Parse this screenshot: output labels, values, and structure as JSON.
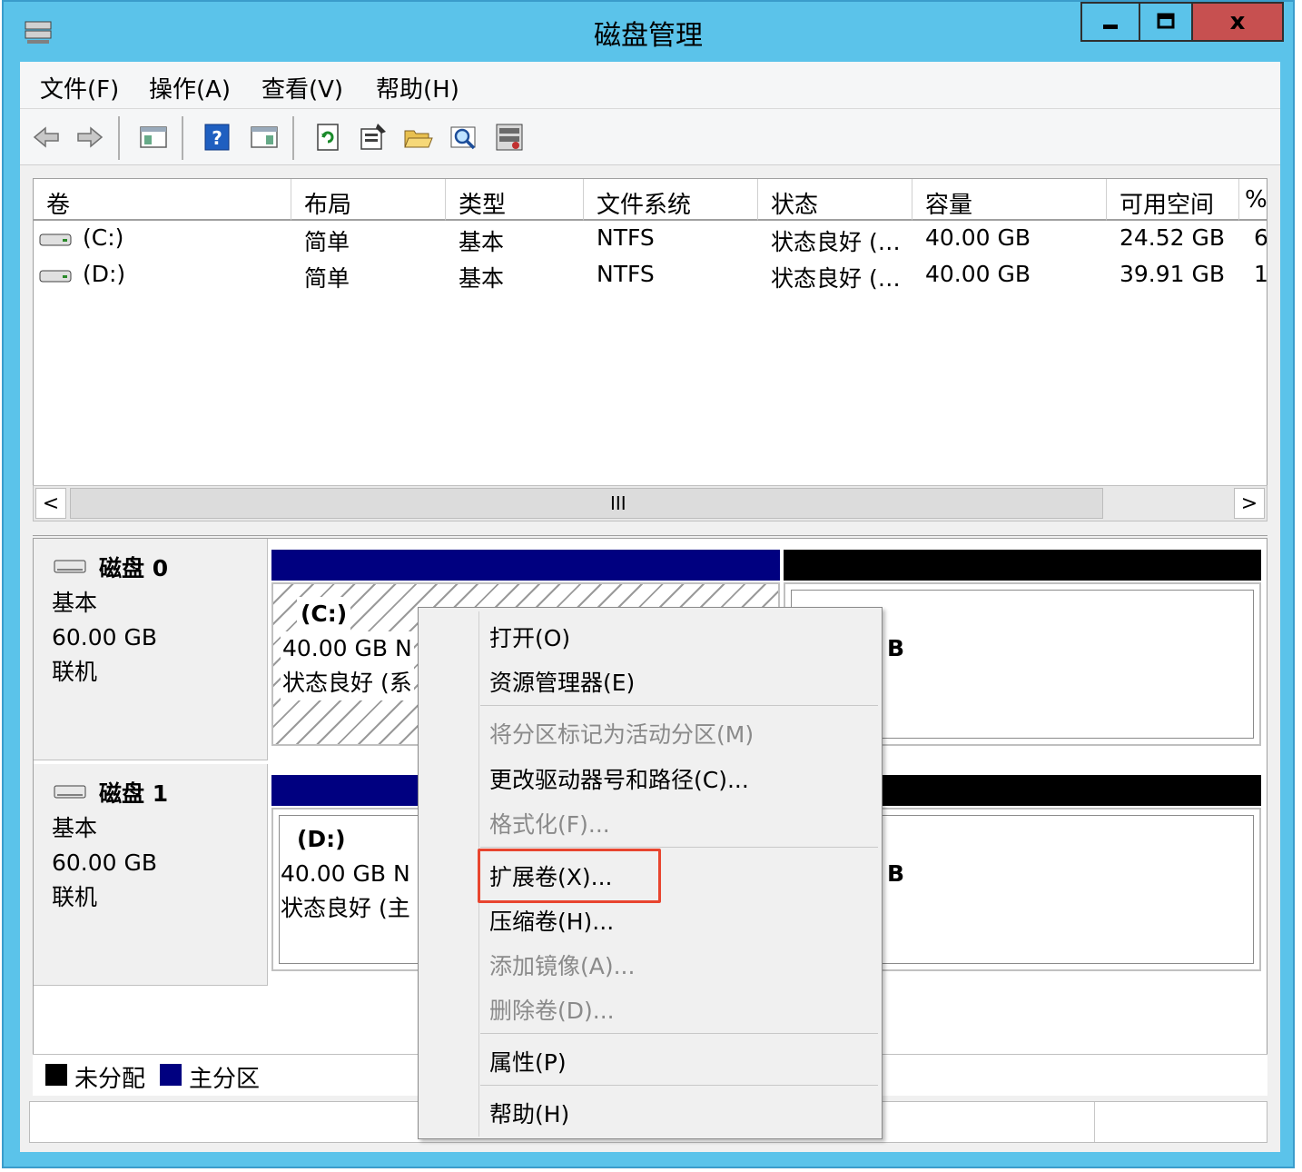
{
  "window": {
    "title": "磁盘管理",
    "controls": {
      "minimize": "▁",
      "maximize": "□",
      "close": "x"
    }
  },
  "menubar": {
    "items": [
      "文件(F)",
      "操作(A)",
      "查看(V)",
      "帮助(H)"
    ]
  },
  "toolbar": {
    "icons": [
      "back-arrow-icon",
      "forward-arrow-icon",
      "console-tree-icon",
      "help-icon",
      "action-pane-icon",
      "refresh-icon",
      "properties-icon",
      "open-folder-icon",
      "search-icon",
      "disk-settings-icon"
    ]
  },
  "volume_list": {
    "columns": [
      "卷",
      "布局",
      "类型",
      "文件系统",
      "状态",
      "容量",
      "可用空间",
      "%"
    ],
    "rows": [
      {
        "volume": "(C:)",
        "layout": "简单",
        "type": "基本",
        "fs": "NTFS",
        "status": "状态良好 (…",
        "capacity": "40.00 GB",
        "free": "24.52 GB",
        "pct": "6"
      },
      {
        "volume": "(D:)",
        "layout": "简单",
        "type": "基本",
        "fs": "NTFS",
        "status": "状态良好 (…",
        "capacity": "40.00 GB",
        "free": "39.91 GB",
        "pct": "1"
      }
    ],
    "scroll_grip": "III",
    "scroll_left": "<",
    "scroll_right": ">"
  },
  "disks": [
    {
      "name": "磁盘 0",
      "type": "基本",
      "size": "60.00 GB",
      "state": "联机",
      "partition": {
        "label": "(C:)",
        "size": "40.00 GB N",
        "status": "状态良好 (系"
      },
      "unallocated_text": "B"
    },
    {
      "name": "磁盘 1",
      "type": "基本",
      "size": "60.00 GB",
      "state": "联机",
      "partition": {
        "label": "(D:)",
        "size": "40.00 GB N",
        "status": "状态良好 (主"
      },
      "unallocated_text": "B"
    }
  ],
  "legend": {
    "items": [
      {
        "label": "未分配",
        "color": "#000000"
      },
      {
        "label": "主分区",
        "color": "#000080"
      }
    ]
  },
  "context_menu": {
    "items": [
      {
        "label": "打开(O)",
        "enabled": true
      },
      {
        "label": "资源管理器(E)",
        "enabled": true
      },
      {
        "label": "将分区标记为活动分区(M)",
        "enabled": false
      },
      {
        "label": "更改驱动器号和路径(C)...",
        "enabled": true
      },
      {
        "label": "格式化(F)...",
        "enabled": false
      },
      {
        "label": "扩展卷(X)...",
        "enabled": true,
        "highlighted": true
      },
      {
        "label": "压缩卷(H)...",
        "enabled": true
      },
      {
        "label": "添加镜像(A)...",
        "enabled": false
      },
      {
        "label": "删除卷(D)...",
        "enabled": false
      },
      {
        "label": "属性(P)",
        "enabled": true
      },
      {
        "label": "帮助(H)",
        "enabled": true
      }
    ]
  },
  "colors": {
    "titlebar": "#5bc3ea",
    "primary_partition": "#000080",
    "unallocated": "#000000",
    "close_button": "#c75050",
    "highlight_box": "#e8452f"
  }
}
